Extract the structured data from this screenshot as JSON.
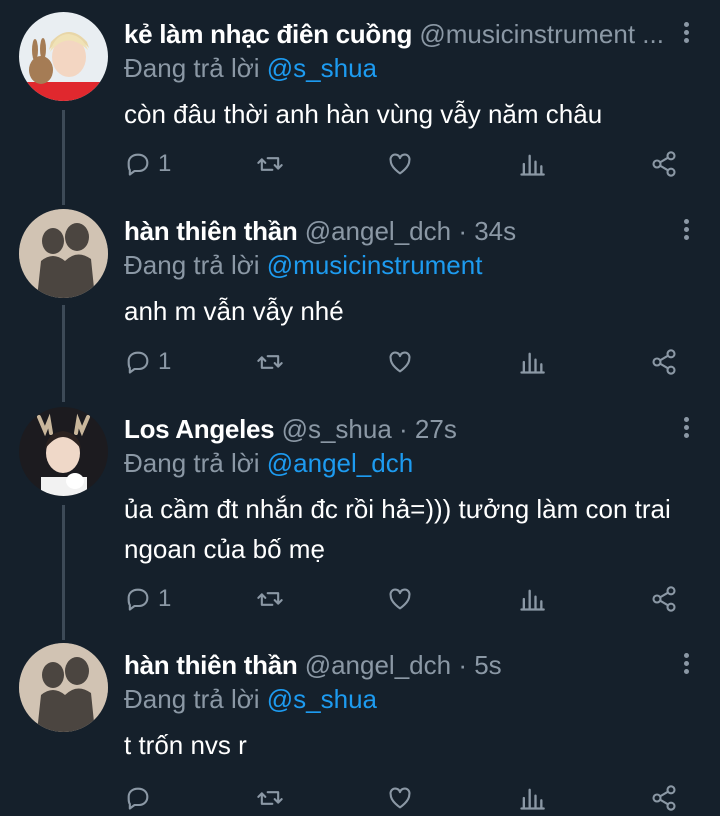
{
  "colors": {
    "background": "#15202b",
    "muted": "#8b98a5",
    "accent": "#1d9bf0",
    "text": "#ffffff"
  },
  "tweets": [
    {
      "name": "kẻ làm nhạc điên cuồng",
      "handle": "@musicinstrument ...",
      "time": "",
      "reply_prefix": "Đang trả lời ",
      "reply_to": "@s_shua",
      "text": "còn đâu thời anh hàn vùng vẫy năm châu",
      "reply_count": "1",
      "avatar": "avatar-blond-with-rabbit"
    },
    {
      "name": "hàn thiên thần",
      "handle": "@angel_dch",
      "time": " · 34s",
      "reply_prefix": "Đang trả lời ",
      "reply_to": "@musicinstrument",
      "text": "anh m vẫn vẫy nhé",
      "reply_count": "1",
      "avatar": "avatar-shadow-silhouette"
    },
    {
      "name": "Los Angeles",
      "handle": "@s_shua",
      "time": " · 27s",
      "reply_prefix": "Đang trả lời ",
      "reply_to": "@angel_dch",
      "text": "ủa cầm đt nhắn đc rồi hả=))) tưởng làm con trai ngoan của bố mẹ",
      "reply_count": "1",
      "avatar": "avatar-person-deer-antlers"
    },
    {
      "name": "hàn thiên thần",
      "handle": "@angel_dch",
      "time": " · 5s",
      "reply_prefix": "Đang trả lời ",
      "reply_to": "@s_shua",
      "text": "t trốn nvs r",
      "reply_count": "",
      "avatar": "avatar-shadow-silhouette"
    }
  ],
  "icons": [
    "reply-icon",
    "retweet-icon",
    "like-icon",
    "views-icon",
    "share-icon",
    "more-icon"
  ]
}
